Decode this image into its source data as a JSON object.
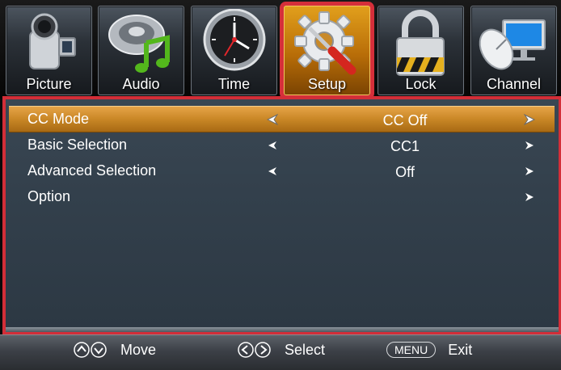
{
  "tabs": [
    {
      "label": "Picture",
      "icon": "camcorder-icon"
    },
    {
      "label": "Audio",
      "icon": "speaker-music-icon"
    },
    {
      "label": "Time",
      "icon": "clock-icon"
    },
    {
      "label": "Setup",
      "icon": "gear-screwdriver-icon",
      "active": true
    },
    {
      "label": "Lock",
      "icon": "padlock-icon"
    },
    {
      "label": "Channel",
      "icon": "satellite-dish-icon"
    }
  ],
  "menu": {
    "rows": [
      {
        "label": "CC Mode",
        "value": "CC Off",
        "selected": true
      },
      {
        "label": "Basic Selection",
        "value": "CC1"
      },
      {
        "label": "Advanced Selection",
        "value": "Off"
      },
      {
        "label": "Option",
        "value": ""
      }
    ]
  },
  "footer": {
    "move_label": "Move",
    "select_label": "Select",
    "menu_key": "MENU",
    "exit_label": "Exit"
  },
  "colors": {
    "highlight_border": "#d32e38",
    "selected_row": "#c98726",
    "panel_bg": "#34414d",
    "active_tab": "#e2a01c"
  }
}
